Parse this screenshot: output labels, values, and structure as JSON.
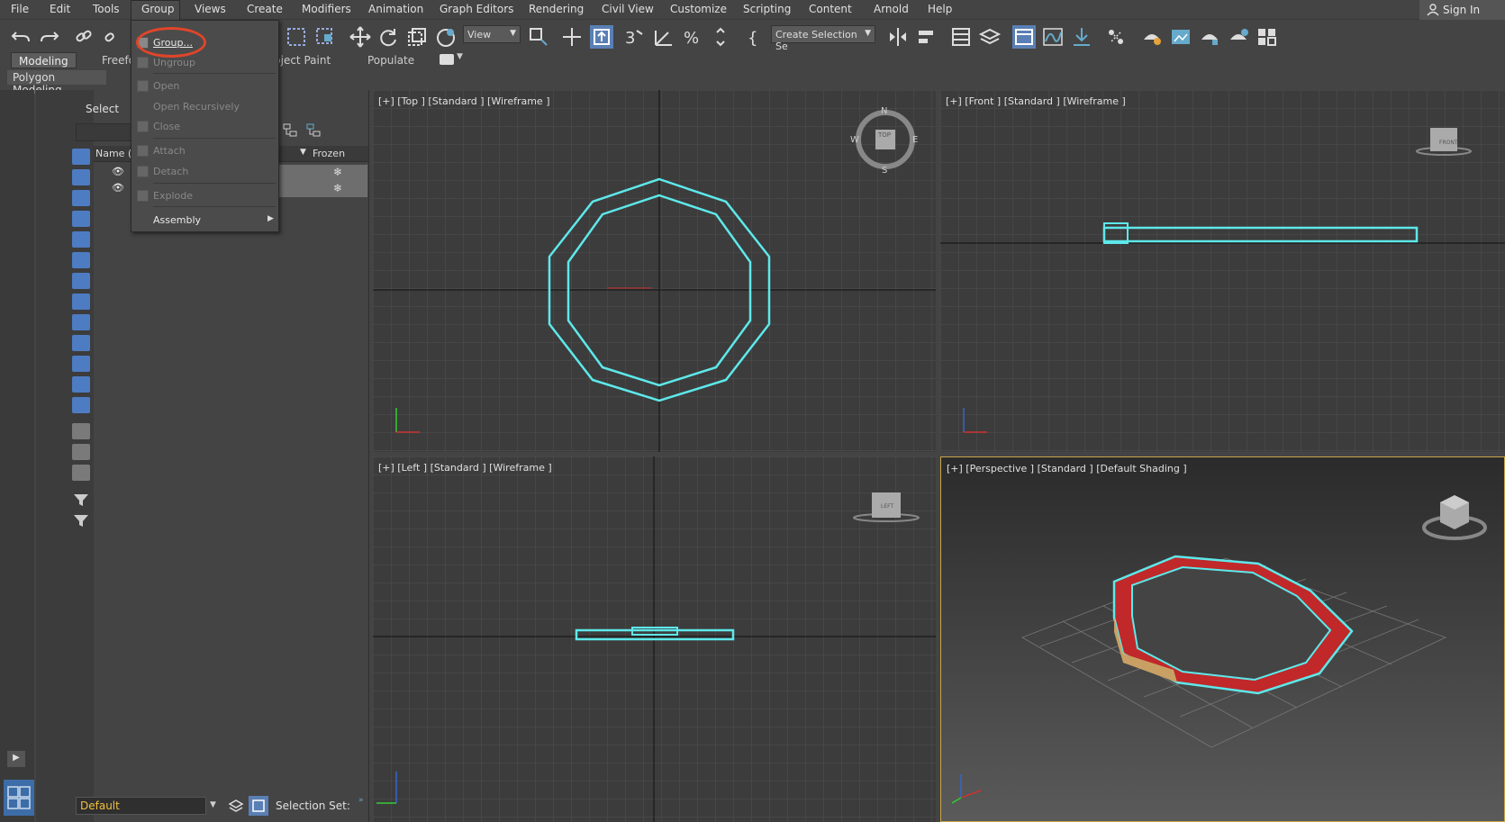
{
  "menubar": {
    "items": [
      {
        "label": "File"
      },
      {
        "label": "Edit"
      },
      {
        "label": "Tools"
      },
      {
        "label": "Group"
      },
      {
        "label": "Views"
      },
      {
        "label": "Create"
      },
      {
        "label": "Modifiers"
      },
      {
        "label": "Animation"
      },
      {
        "label": "Graph Editors"
      },
      {
        "label": "Rendering"
      },
      {
        "label": "Civil View"
      },
      {
        "label": "Customize"
      },
      {
        "label": "Scripting"
      },
      {
        "label": "Content"
      },
      {
        "label": "Arnold"
      },
      {
        "label": "Help"
      }
    ],
    "signin_label": "Sign In"
  },
  "toolbar": {
    "view_dropdown": "View",
    "selection_set_dropdown": "Create Selection Se"
  },
  "ribbon": {
    "tabs": [
      {
        "label": "Modeling"
      },
      {
        "label": "Freefo"
      },
      {
        "label": "bject Paint"
      },
      {
        "label": "Populate"
      }
    ],
    "panel_label": "Polygon Modeling"
  },
  "group_menu": {
    "items": [
      {
        "label": "Group...",
        "enabled": true
      },
      {
        "label": "Ungroup",
        "enabled": false
      },
      {
        "label": "Open",
        "enabled": false
      },
      {
        "label": "Open Recursively",
        "enabled": false
      },
      {
        "label": "Close",
        "enabled": false
      },
      {
        "label": "Attach",
        "enabled": false
      },
      {
        "label": "Detach",
        "enabled": false
      },
      {
        "label": "Explode",
        "enabled": false
      },
      {
        "label": "Assembly",
        "enabled": true
      }
    ]
  },
  "scene_explorer": {
    "select_label": "Select",
    "col_name": "Name (S",
    "col_frozen": "Frozen"
  },
  "viewports": {
    "top": "[+] [Top ] [Standard ] [Wireframe ]",
    "front": "[+] [Front ] [Standard ] [Wireframe ]",
    "left": "[+] [Left ] [Standard ] [Wireframe ]",
    "perspective": "[+] [Perspective ] [Standard ] [Default Shading ]"
  },
  "viewcube": {
    "top": "TOP",
    "front": "FRONT",
    "left": "LEFT",
    "compass_n": "N",
    "compass_s": "S",
    "compass_e": "E",
    "compass_w": "W"
  },
  "bottom": {
    "layer": "Default",
    "selection_set_label": "Selection Set:"
  },
  "colors": {
    "selection": "#5ee8ea",
    "highlight_circle": "#e0452a",
    "ring_red": "#c0282a",
    "ring_box": "#c9a064",
    "active_border": "#c9a64a"
  }
}
